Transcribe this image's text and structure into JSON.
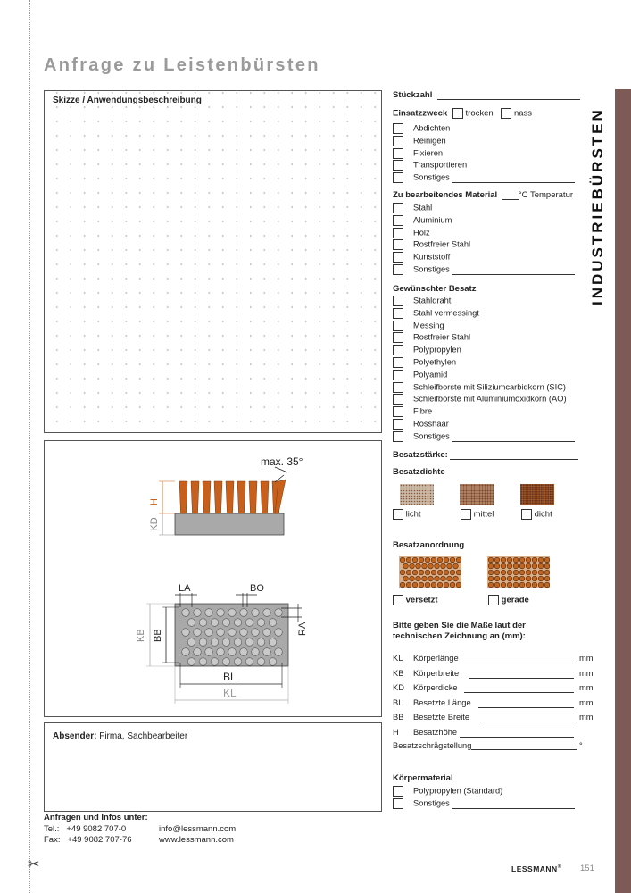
{
  "title": "Anfrage zu Leistenbürsten",
  "vertical_title": "INDUSTRIEBÜRSTEN",
  "sketch_label": "Skizze / Anwendungsbeschreibung",
  "drawing": {
    "max_angle": "max. 35°",
    "labels": {
      "H": "H",
      "KD": "KD",
      "LA": "LA",
      "BO": "BO",
      "KB": "KB",
      "BB": "BB",
      "RA": "RA",
      "BL": "BL",
      "KL": "KL"
    }
  },
  "sender": {
    "label_bold": "Absender:",
    "label_rest": " Firma, Sachbearbeiter"
  },
  "contact": {
    "heading": "Anfragen und Infos unter:",
    "tel_label": "Tel.:",
    "tel": "+49 9082 707-0",
    "email": "info@lessmann.com",
    "fax_label": "Fax:",
    "fax": "+49 9082 707-76",
    "web": "www.lessmann.com"
  },
  "form": {
    "stueckzahl": "Stückzahl",
    "einsatzzweck": {
      "label": "Einsatzzweck",
      "trocken": "trocken",
      "nass": "nass",
      "items": [
        "Abdichten",
        "Reinigen",
        "Fixieren",
        "Transportieren",
        "Sonstiges"
      ]
    },
    "material": {
      "label": "Zu bearbeitendes Material",
      "temp": "°C Temperatur",
      "items": [
        "Stahl",
        "Aluminium",
        "Holz",
        "Rostfreier Stahl",
        "Kunststoff",
        "Sonstiges"
      ]
    },
    "besatz": {
      "label": "Gewünschter Besatz",
      "items": [
        "Stahldraht",
        "Stahl vermessingt",
        "Messing",
        "Rostfreier Stahl",
        "Polypropylen",
        "Polyethylen",
        "Polyamid",
        "Schleifborste mit Siliziumcarbidkorn (SIC)",
        "Schleifborste mit Aluminiumoxidkorn (AO)",
        "Fibre",
        "Rosshaar",
        "Sonstiges"
      ]
    },
    "besatzstaerke": "Besatzstärke:",
    "besatzdichte": {
      "label": "Besatzdichte",
      "licht": "licht",
      "mittel": "mittel",
      "dicht": "dicht"
    },
    "besatzanordnung": {
      "label": "Besatzanordnung",
      "versetzt": "versetzt",
      "gerade": "gerade"
    },
    "masse": {
      "label_line1": "Bitte geben Sie die Maße laut der",
      "label_line2": "technischen Zeichnung an (mm):",
      "rows": [
        {
          "code": "KL",
          "name": "Körperlänge",
          "unit": "mm"
        },
        {
          "code": "KB",
          "name": "Körperbreite",
          "unit": "mm"
        },
        {
          "code": "KD",
          "name": "Körperdicke",
          "unit": "mm"
        },
        {
          "code": "BL",
          "name": "Besetzte Länge",
          "unit": "mm"
        },
        {
          "code": "BB",
          "name": "Besetzte Breite",
          "unit": "mm"
        },
        {
          "code": "H",
          "name": "Besatzhöhe",
          "unit": ""
        }
      ],
      "schraeg": "Besatzschrägstellung",
      "schraeg_unit": "°"
    },
    "koerpermaterial": {
      "label": "Körpermaterial",
      "items": [
        "Polypropylen (Standard)",
        "Sonstiges"
      ]
    }
  },
  "footer": {
    "brand": "LESSMANN",
    "reg": "®",
    "page": "151"
  },
  "colors": {
    "sidebar": "#7d5a56",
    "bristle": "#c8601c",
    "body": "#a9a9a9"
  }
}
